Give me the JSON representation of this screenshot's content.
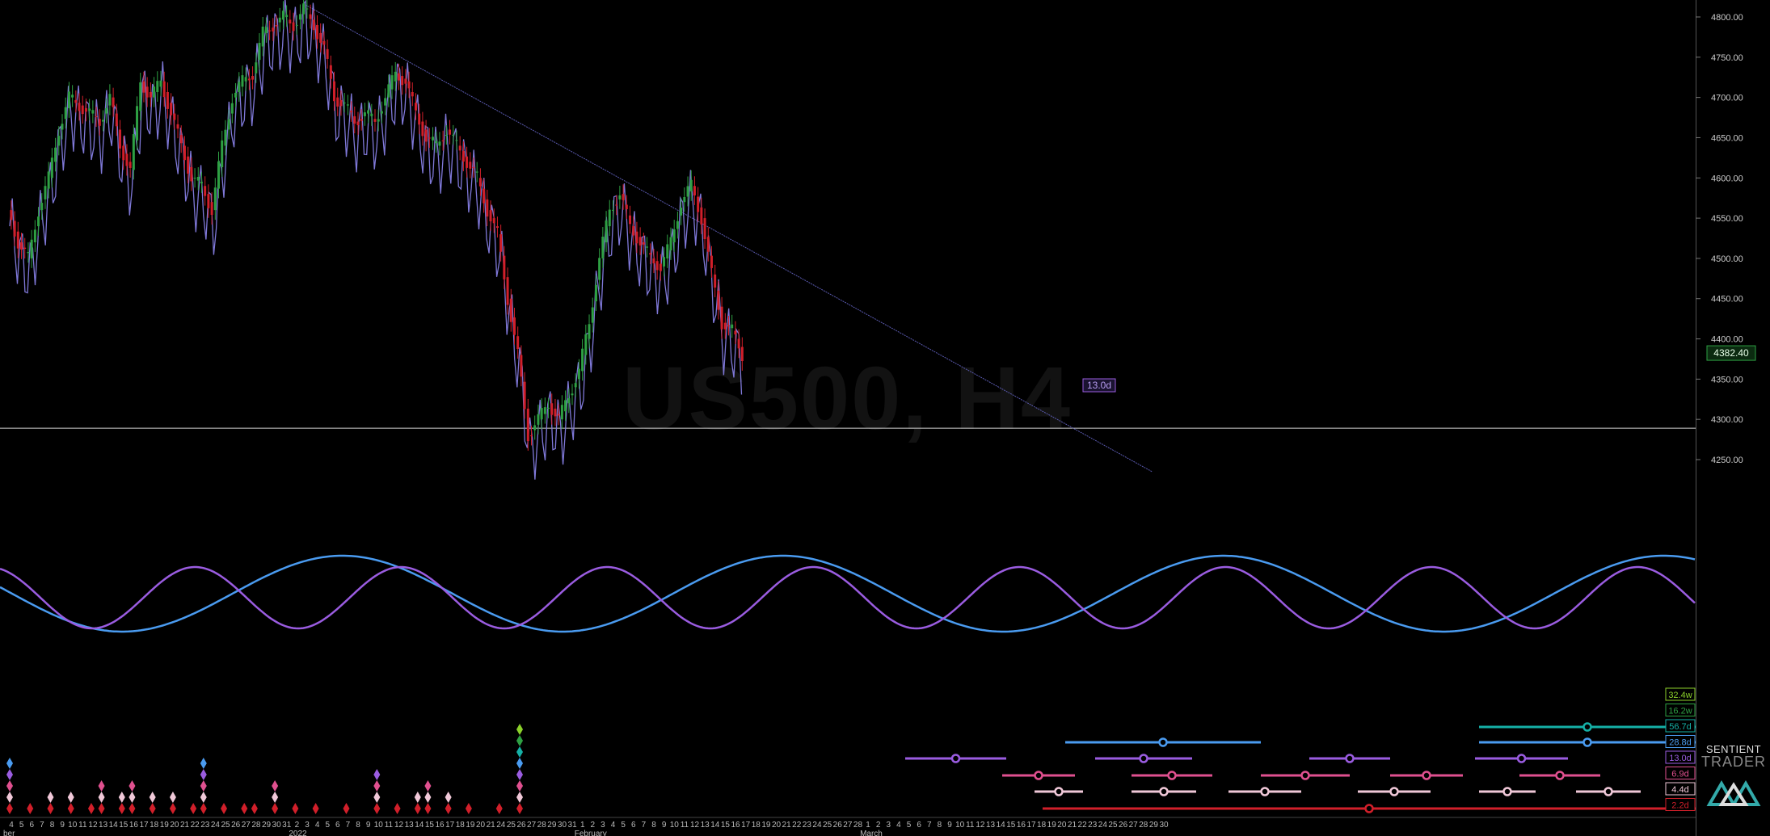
{
  "chart_data": {
    "type": "line",
    "watermark": "US500, H4",
    "price_scale": {
      "ylim": [
        4205,
        4818
      ],
      "ticks": [
        4250,
        4300,
        4350,
        4400,
        4450,
        4500,
        4550,
        4600,
        4650,
        4700,
        4750,
        4800
      ],
      "tick_labels": [
        "4250.00",
        "4300.00",
        "4350.00",
        "4400.00",
        "4450.00",
        "4500.00",
        "4550.00",
        "4600.00",
        "4650.00",
        "4700.00",
        "4750.00",
        "4800.00"
      ],
      "current_price": 4382.4,
      "current_label": "4382.40"
    },
    "horizontal_line": 4289,
    "x_axis": {
      "days": [
        "4",
        "5",
        "6",
        "7",
        "8",
        "9",
        "10",
        "11",
        "12",
        "13",
        "14",
        "15",
        "16",
        "17",
        "18",
        "19",
        "20",
        "21",
        "22",
        "23",
        "24",
        "25",
        "26",
        "27",
        "28",
        "29",
        "30",
        "31",
        "2",
        "3",
        "4",
        "5",
        "6",
        "7",
        "8",
        "9",
        "10",
        "11",
        "12",
        "13",
        "14",
        "15",
        "16",
        "17",
        "18",
        "19",
        "20",
        "21",
        "24",
        "25",
        "26",
        "27",
        "28",
        "29",
        "30",
        "31",
        "1",
        "2",
        "3",
        "4",
        "5",
        "6",
        "7",
        "8",
        "9",
        "10",
        "11",
        "12",
        "13",
        "14",
        "15",
        "16",
        "17",
        "18",
        "19",
        "20",
        "21",
        "22",
        "23",
        "24",
        "25",
        "26",
        "27",
        "28",
        "1",
        "2",
        "3",
        "4",
        "5",
        "6",
        "7",
        "8",
        "9",
        "10",
        "11",
        "12",
        "13",
        "14",
        "15",
        "16",
        "17",
        "18",
        "19",
        "20",
        "21",
        "22",
        "23",
        "24",
        "25",
        "26",
        "27",
        "28",
        "29",
        "30"
      ],
      "months": [
        {
          "label": "ber",
          "day_index": 0
        },
        {
          "label": "2022",
          "day_index": 28
        },
        {
          "label": "February",
          "day_index": 56
        },
        {
          "label": "March",
          "day_index": 84
        }
      ]
    },
    "price_series": {
      "name": "US500 H4",
      "points": [
        [
          0,
          4560
        ],
        [
          1,
          4520
        ],
        [
          2,
          4500
        ],
        [
          3,
          4560
        ],
        [
          4,
          4600
        ],
        [
          5,
          4660
        ],
        [
          6,
          4700
        ],
        [
          7,
          4690
        ],
        [
          8,
          4680
        ],
        [
          9,
          4670
        ],
        [
          10,
          4700
        ],
        [
          11,
          4640
        ],
        [
          12,
          4610
        ],
        [
          13,
          4720
        ],
        [
          14,
          4700
        ],
        [
          15,
          4720
        ],
        [
          16,
          4680
        ],
        [
          17,
          4640
        ],
        [
          18,
          4600
        ],
        [
          19,
          4590
        ],
        [
          20,
          4560
        ],
        [
          21,
          4640
        ],
        [
          22,
          4700
        ],
        [
          23,
          4720
        ],
        [
          24,
          4730
        ],
        [
          25,
          4780
        ],
        [
          26,
          4790
        ],
        [
          27,
          4800
        ],
        [
          28,
          4790
        ],
        [
          29,
          4810
        ],
        [
          30,
          4790
        ],
        [
          31,
          4760
        ],
        [
          32,
          4700
        ],
        [
          33,
          4690
        ],
        [
          34,
          4670
        ],
        [
          35,
          4680
        ],
        [
          36,
          4670
        ],
        [
          37,
          4700
        ],
        [
          38,
          4730
        ],
        [
          39,
          4720
        ],
        [
          40,
          4680
        ],
        [
          41,
          4650
        ],
        [
          42,
          4640
        ],
        [
          43,
          4660
        ],
        [
          44,
          4640
        ],
        [
          45,
          4620
        ],
        [
          46,
          4600
        ],
        [
          47,
          4560
        ],
        [
          48,
          4530
        ],
        [
          49,
          4450
        ],
        [
          50,
          4380
        ],
        [
          51,
          4280
        ],
        [
          52,
          4300
        ],
        [
          53,
          4320
        ],
        [
          54,
          4300
        ],
        [
          55,
          4330
        ],
        [
          56,
          4360
        ],
        [
          57,
          4420
        ],
        [
          58,
          4500
        ],
        [
          59,
          4560
        ],
        [
          60,
          4580
        ],
        [
          61,
          4540
        ],
        [
          62,
          4520
        ],
        [
          63,
          4500
        ],
        [
          64,
          4490
        ],
        [
          65,
          4520
        ],
        [
          66,
          4570
        ],
        [
          67,
          4590
        ],
        [
          68,
          4550
        ],
        [
          69,
          4480
        ],
        [
          70,
          4420
        ],
        [
          71,
          4410
        ],
        [
          72,
          4380
        ]
      ]
    },
    "cycle_lines": [
      {
        "label": "13.0d",
        "color": "#9a5ce0"
      },
      {
        "label": "28.8d",
        "color": "#4a9bf0"
      }
    ],
    "trendline": {
      "from": [
        29,
        4815
      ],
      "to": [
        112,
        4235
      ]
    },
    "right_labels": [
      {
        "text": "32.4w",
        "color": "#8bd12a"
      },
      {
        "text": "16.2w",
        "color": "#2ea043"
      },
      {
        "text": "56.7d",
        "color": "#15b0a6"
      },
      {
        "text": "28.8d",
        "color": "#4a9bf0"
      },
      {
        "text": "13.0d",
        "color": "#9a5ce0"
      },
      {
        "text": "6.9d",
        "color": "#e0508f"
      },
      {
        "text": "4.4d",
        "color": "#f0c8d8"
      },
      {
        "text": "2.2d",
        "color": "#d11f2a"
      }
    ],
    "cycle_label": "13.0d"
  },
  "logo": {
    "line1": "SENTIENT",
    "line2": "TRADER"
  },
  "colors": {
    "up": "#2ea043",
    "down": "#d11f2a",
    "price_line": "#7f78d8",
    "cycle_purple": "#9a5ce0",
    "cycle_blue": "#4a9bf0",
    "current_price": "#2ea043"
  }
}
